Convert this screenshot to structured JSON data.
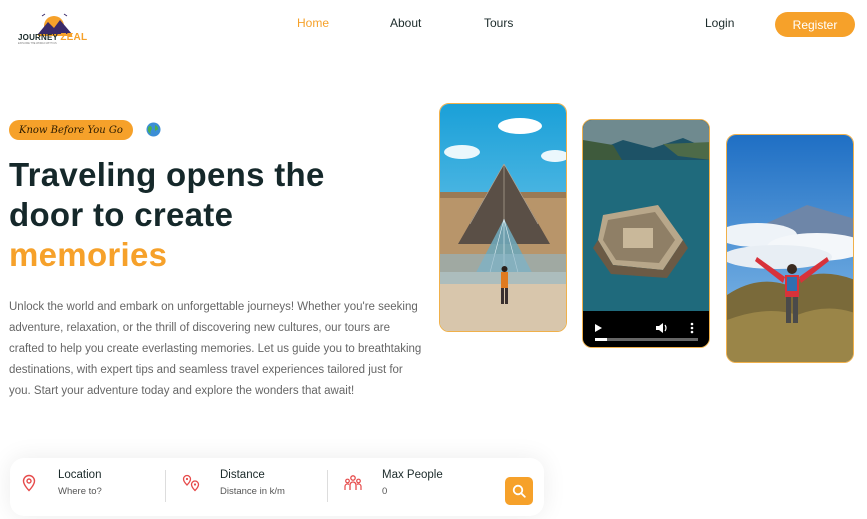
{
  "brand": {
    "name_part1": "JOURNEY",
    "name_part2": "ZEAL",
    "tagline": "EXPLORE THE WORLD WITH US",
    "accent_color": "#f6a12a"
  },
  "nav": {
    "links": [
      "Home",
      "About",
      "Tours"
    ],
    "active": "Home",
    "login": "Login",
    "register": "Register"
  },
  "hero": {
    "badge": "Know Before You Go",
    "badge_icon": "globe-icon",
    "title_line1": "Traveling opens the",
    "title_line2": "door to create",
    "title_accent": "memories",
    "description": "Unlock the world and embark on unforgettable journeys! Whether you're seeking adventure, relaxation, or the thrill of discovering new cultures, our tours are crafted to help you create everlasting memories. Let us guide you to breathtaking destinations, with expert tips and seamless travel experiences tailored just for you. Start your adventure today and explore the wonders that await!"
  },
  "gallery": {
    "photos": [
      "louvre-pyramid-photo",
      "island-fortress-video",
      "mountain-hiker-photo"
    ],
    "video": {
      "progress": 0.12
    }
  },
  "search": {
    "fields": [
      {
        "label": "Location",
        "placeholder": "Where to?",
        "icon": "map-pin-icon"
      },
      {
        "label": "Distance",
        "placeholder": "Distance in k/m",
        "icon": "route-pins-icon"
      },
      {
        "label": "Max People",
        "value": "0",
        "icon": "people-icon"
      }
    ],
    "button_icon": "search-icon"
  }
}
